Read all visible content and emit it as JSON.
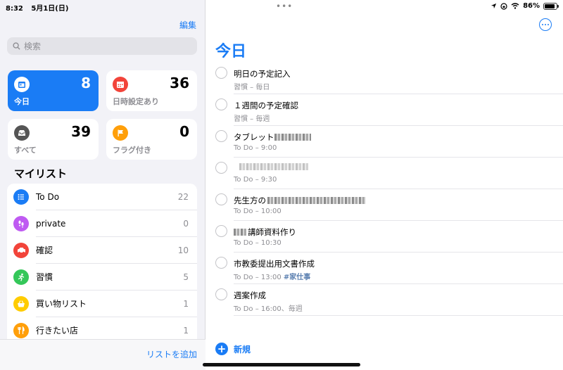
{
  "status": {
    "time": "8:32",
    "date": "5月1日(日)",
    "battery": "86%",
    "battery_level": 0.86
  },
  "sidebar": {
    "edit_label": "編集",
    "search_placeholder": "検索",
    "cards": [
      {
        "label": "今日",
        "count": "8",
        "icon": "calendar-icon",
        "color": "#1a7cf5"
      },
      {
        "label": "日時設定あり",
        "count": "36",
        "icon": "calendar-grid-icon",
        "color": "#f2443a"
      },
      {
        "label": "すべて",
        "count": "39",
        "icon": "tray-icon",
        "color": "#555555"
      },
      {
        "label": "フラグ付き",
        "count": "0",
        "icon": "flag-icon",
        "color": "#ff9f0a"
      }
    ],
    "my_lists_title": "マイリスト",
    "lists": [
      {
        "name": "To Do",
        "count": "22",
        "icon": "list-icon",
        "color": "#1a7cf5"
      },
      {
        "name": "private",
        "count": "0",
        "icon": "footprints-icon",
        "color": "#bf5af2"
      },
      {
        "name": "確認",
        "count": "10",
        "icon": "car-icon",
        "color": "#f2443a"
      },
      {
        "name": "習慣",
        "count": "5",
        "icon": "running-icon",
        "color": "#34c759"
      },
      {
        "name": "買い物リスト",
        "count": "1",
        "icon": "basket-icon",
        "color": "#ffcc00"
      },
      {
        "name": "行きたい店",
        "count": "1",
        "icon": "fork-knife-icon",
        "color": "#ff9f0a"
      }
    ],
    "add_list_label": "リストを追加"
  },
  "main": {
    "title": "今日",
    "tasks": [
      {
        "title": "明日の予定記入",
        "subtitle": "習慣 – 毎日",
        "tag": ""
      },
      {
        "title": "１週間の予定確認",
        "subtitle": "習慣 – 毎週",
        "tag": ""
      },
      {
        "title": "タブレット",
        "subtitle": "To Do – 9:00",
        "tag": ""
      },
      {
        "title": "",
        "subtitle": "To Do – 9:30",
        "tag": ""
      },
      {
        "title": "先生方の",
        "subtitle": "To Do – 10:00",
        "tag": ""
      },
      {
        "title": "講師資料作り",
        "subtitle": "To Do – 10:30",
        "tag": ""
      },
      {
        "title": "市教委提出用文書作成",
        "subtitle": "To Do – 13:00",
        "tag": "#家仕事"
      },
      {
        "title": "週案作成",
        "subtitle": "To Do – 16:00、毎週",
        "tag": ""
      }
    ],
    "new_label": "新規"
  }
}
